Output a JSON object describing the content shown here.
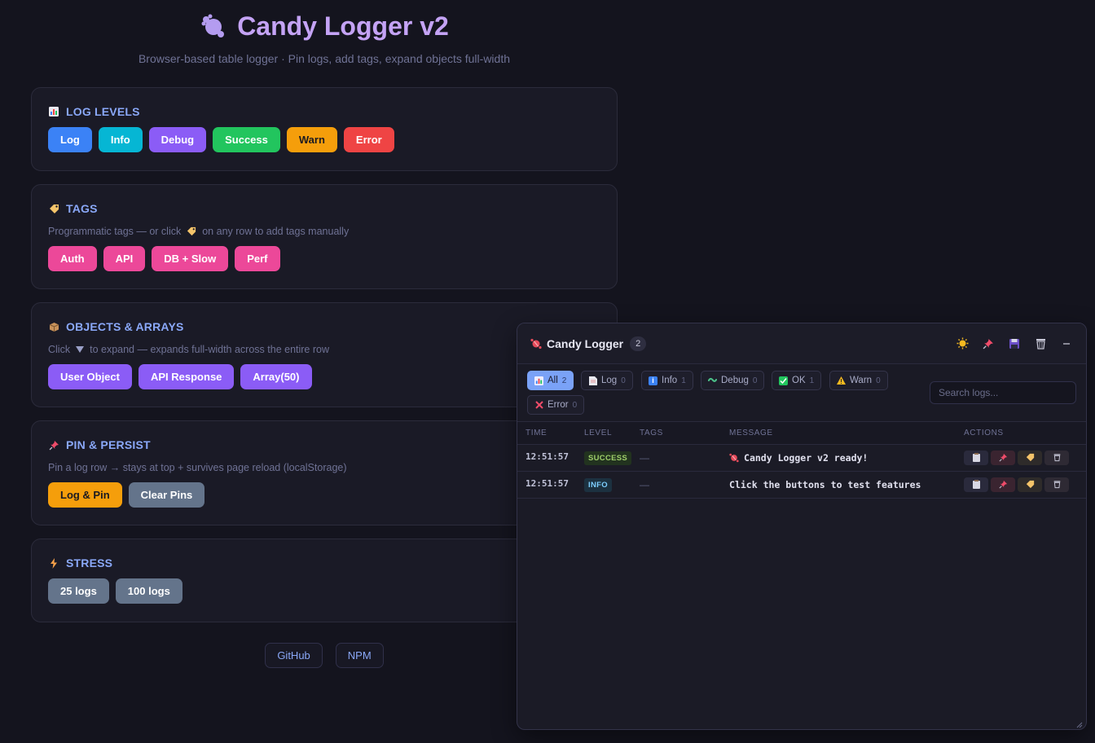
{
  "hero": {
    "title": "Candy Logger v2",
    "subtitle": "Browser-based table logger · Pin logs, add tags, expand objects full-width"
  },
  "sections": {
    "levels": {
      "icon": "bar-chart-icon",
      "title": "LOG LEVELS",
      "buttons": [
        {
          "label": "Log",
          "color": "#3b82f6"
        },
        {
          "label": "Info",
          "color": "#06b6d4"
        },
        {
          "label": "Debug",
          "color": "#8b5cf6"
        },
        {
          "label": "Success",
          "color": "#22c55e"
        },
        {
          "label": "Warn",
          "color": "#f59e0b"
        },
        {
          "label": "Error",
          "color": "#ef4444"
        }
      ]
    },
    "tags": {
      "icon": "tag-icon",
      "title": "TAGS",
      "desc_before": "Programmatic tags — or click",
      "desc_after": "on any row to add tags manually",
      "buttons": [
        {
          "label": "Auth",
          "color": "#ec4899"
        },
        {
          "label": "API",
          "color": "#ec4899"
        },
        {
          "label": "DB + Slow",
          "color": "#ec4899"
        },
        {
          "label": "Perf",
          "color": "#ec4899"
        }
      ]
    },
    "objects": {
      "icon": "package-icon",
      "title": "OBJECTS & ARRAYS",
      "desc_before": "Click",
      "desc_after": "to expand — expands full-width across the entire row",
      "buttons": [
        {
          "label": "User Object",
          "color": "#8b5cf6"
        },
        {
          "label": "API Response",
          "color": "#8b5cf6"
        },
        {
          "label": "Array(50)",
          "color": "#8b5cf6"
        }
      ]
    },
    "pins": {
      "icon": "pin-icon",
      "title": "PIN & PERSIST",
      "desc": "Pin a log row → stays at top + survives page reload (localStorage)",
      "buttons": [
        {
          "label": "Log & Pin",
          "color": "#f59e0b"
        },
        {
          "label": "Clear Pins",
          "color": "#64748b"
        }
      ]
    },
    "stress": {
      "icon": "lightning-icon",
      "title": "STRESS",
      "buttons": [
        {
          "label": "25 logs",
          "color": "#64748b"
        },
        {
          "label": "100 logs",
          "color": "#64748b"
        }
      ]
    }
  },
  "footer": {
    "github": "GitHub",
    "npm": "NPM"
  },
  "logger": {
    "title": "Candy Logger",
    "count": "2",
    "tools": [
      "theme-sun-icon",
      "pin-icon",
      "save-icon",
      "clear-icon",
      "minimize-icon"
    ],
    "filters": [
      {
        "label": "All",
        "count": "2",
        "active": true
      },
      {
        "label": "Log",
        "count": "0"
      },
      {
        "label": "Info",
        "count": "1"
      },
      {
        "label": "Debug",
        "count": "0"
      },
      {
        "label": "OK",
        "count": "1"
      },
      {
        "label": "Warn",
        "count": "0"
      },
      {
        "label": "Error",
        "count": "0"
      }
    ],
    "search_placeholder": "Search logs...",
    "columns": [
      "TIME",
      "LEVEL",
      "TAGS",
      "MESSAGE",
      "ACTIONS"
    ],
    "rows": [
      {
        "time": "12:51:57",
        "level": "SUCCESS",
        "tags": "—",
        "message": "Candy Logger v2 ready!"
      },
      {
        "time": "12:51:57",
        "level": "INFO",
        "tags": "—",
        "message": "Click the buttons to test features"
      }
    ]
  }
}
